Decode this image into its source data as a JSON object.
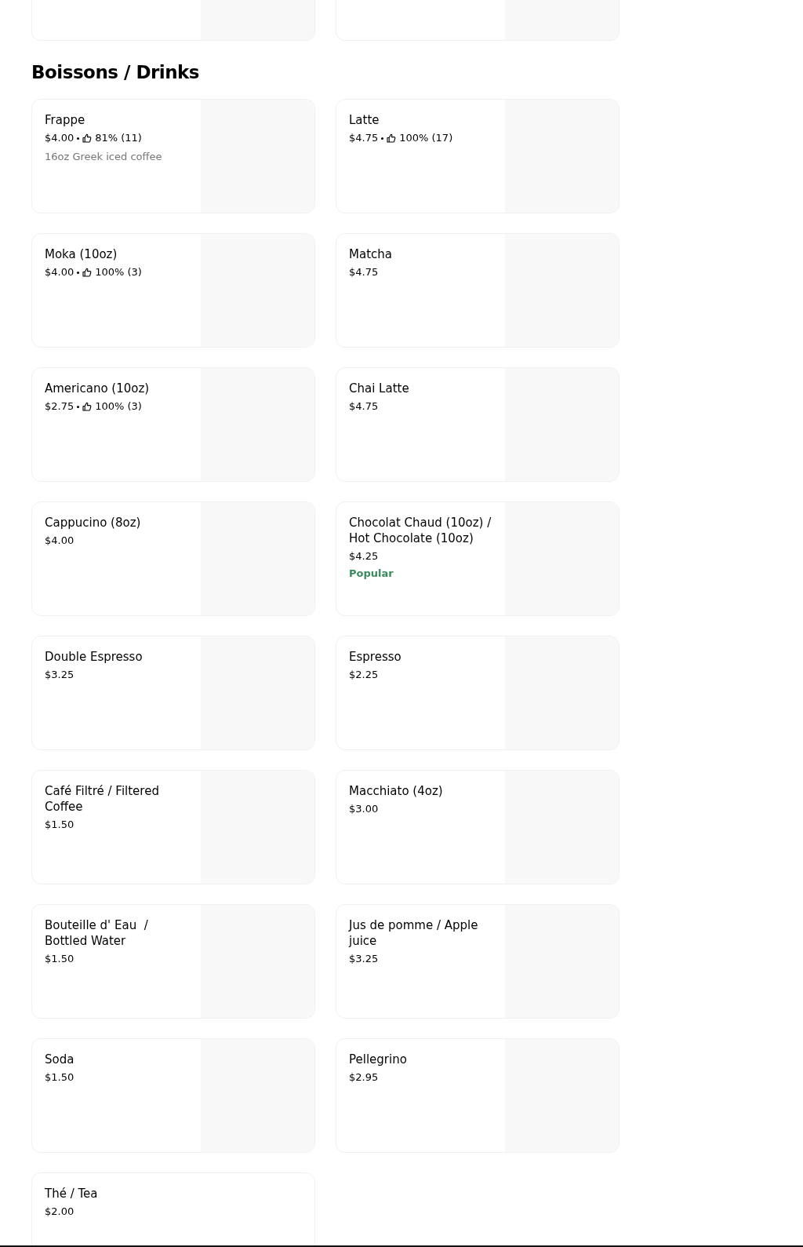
{
  "previous_section_cards": [
    {
      "image_placeholder": true
    },
    {
      "image_placeholder": true
    }
  ],
  "section": {
    "title": "Boissons / Drinks",
    "items": [
      {
        "name": "Frappe",
        "price": "$4.00",
        "rating": "81% (11)",
        "description": "16oz Greek iced coffee",
        "image_placeholder": true
      },
      {
        "name": "Latte",
        "price": "$4.75",
        "rating": "100% (17)",
        "image_placeholder": true
      },
      {
        "name": "Moka (10oz)",
        "price": "$4.00",
        "rating": "100% (3)",
        "image_placeholder": true
      },
      {
        "name": "Matcha",
        "price": "$4.75",
        "image_placeholder": true
      },
      {
        "name": "Americano (10oz)",
        "price": "$2.75",
        "rating": "100% (3)",
        "image_placeholder": true
      },
      {
        "name": "Chai Latte",
        "price": "$4.75",
        "image_placeholder": true
      },
      {
        "name": "Cappucino (8oz)",
        "price": "$4.00",
        "image_placeholder": true
      },
      {
        "name": "Chocolat Chaud (10oz) / Hot Chocolate (10oz)",
        "price": "$4.25",
        "badge": "Popular",
        "image_placeholder": true
      },
      {
        "name": "Double Espresso",
        "price": "$3.25",
        "image_placeholder": true
      },
      {
        "name": "Espresso",
        "price": "$2.25",
        "image_placeholder": true
      },
      {
        "name": "Café Filtré / Filtered Coffee",
        "price": "$1.50",
        "image_placeholder": true
      },
      {
        "name": "Macchiato (4oz)",
        "price": "$3.00",
        "image_placeholder": true
      },
      {
        "name": "Bouteille d' Eau  / Bottled Water",
        "price": "$1.50",
        "image_placeholder": true
      },
      {
        "name": "Jus de pomme / Apple juice",
        "price": "$3.25",
        "image_placeholder": true
      },
      {
        "name": "Soda",
        "price": "$1.50",
        "image_placeholder": true
      },
      {
        "name": "Pellegrino",
        "price": "$2.95",
        "image_placeholder": true
      },
      {
        "name": "Thé / Tea",
        "price": "$2.00",
        "image_placeholder": false
      }
    ]
  }
}
